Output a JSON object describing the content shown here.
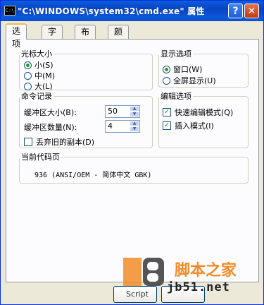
{
  "titlebar": {
    "app_icon_text": "C:\\",
    "title": "\"C:\\WINDOWS\\system32\\cmd.exe\" 属性",
    "help": "?",
    "close": "✕"
  },
  "tabs": [
    "选项",
    "字体",
    "布局",
    "颜色"
  ],
  "cursor_size": {
    "legend": "光标大小",
    "options": [
      {
        "label": "小(S)",
        "selected": true
      },
      {
        "label": "中(M)",
        "selected": false
      },
      {
        "label": "大(L)",
        "selected": false
      }
    ]
  },
  "display_options": {
    "legend": "显示选项",
    "options": [
      {
        "label": "窗口(W)",
        "selected": true
      },
      {
        "label": "全屏显示(U)",
        "selected": false
      }
    ]
  },
  "command_history": {
    "legend": "命令记录",
    "buffer_size_label": "缓冲区大小(B):",
    "buffer_size_value": "50",
    "buffer_count_label": "缓冲区数量(N):",
    "buffer_count_value": "4",
    "discard_label": "丢弃旧的副本(D)",
    "discard_checked": false
  },
  "edit_options": {
    "legend": "编辑选项",
    "quick_edit_label": "快速编辑模式(Q)",
    "quick_edit_checked": true,
    "insert_label": "插入模式(I)",
    "insert_checked": true
  },
  "code_page": {
    "legend": "当前代码页",
    "value": "936   (ANSI/OEM - 简体中文 GBK)"
  },
  "watermark": {
    "logo": "JB",
    "site": "脚本之家",
    "url": "jb51.net",
    "script": "Script"
  },
  "colors": {
    "title_blue": "#0842c2",
    "face": "#ece9d8",
    "watermark_orange": "#f28c28"
  }
}
